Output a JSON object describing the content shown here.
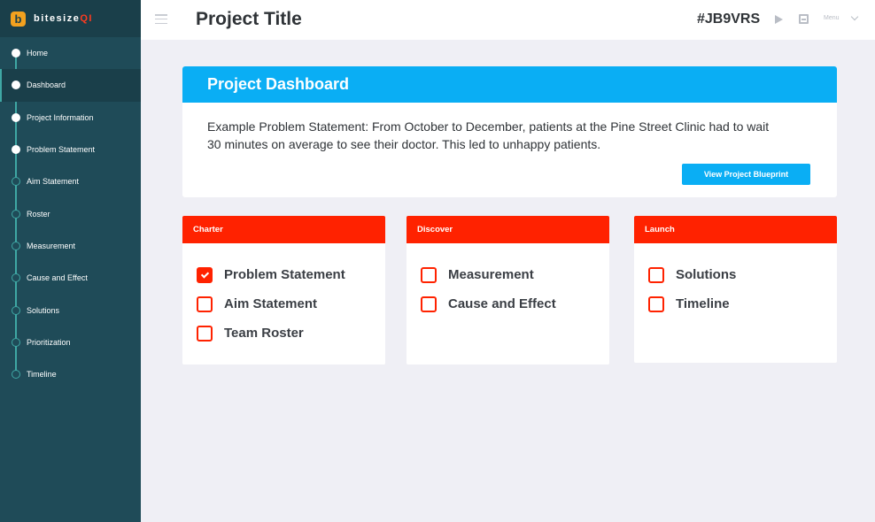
{
  "app": {
    "logo_letter": "b",
    "logo_name_main": "bitesize",
    "logo_name_accent": "QI"
  },
  "sidebar": {
    "items": [
      {
        "label": "Home",
        "state": "done"
      },
      {
        "label": "Dashboard",
        "state": "active"
      },
      {
        "label": "Project Information",
        "state": "done"
      },
      {
        "label": "Problem Statement",
        "state": "done"
      },
      {
        "label": "Aim Statement",
        "state": "todo"
      },
      {
        "label": "Roster",
        "state": "todo"
      },
      {
        "label": "Measurement",
        "state": "todo"
      },
      {
        "label": "Cause and Effect",
        "state": "todo"
      },
      {
        "label": "Solutions",
        "state": "todo"
      },
      {
        "label": "Prioritization",
        "state": "todo"
      },
      {
        "label": "Timeline",
        "state": "todo"
      }
    ]
  },
  "header": {
    "title": "Project Title",
    "project_code": "#JB9VRS",
    "menu_label": "Menu",
    "icons": [
      "hamburger-icon",
      "play-icon",
      "save-icon",
      "chevron-down-icon"
    ]
  },
  "dashboard": {
    "title": "Project Dashboard",
    "problem_statement": "Example Problem Statement: From October to December, patients at the Pine Street Clinic had to wait 30 minutes on average to see their doctor. This led to unhappy patients.",
    "blueprint_button": "View Project Blueprint"
  },
  "phases": [
    {
      "title": "Charter",
      "items": [
        {
          "label": "Problem Statement",
          "checked": true
        },
        {
          "label": "Aim Statement",
          "checked": false
        },
        {
          "label": "Team Roster",
          "checked": false
        }
      ]
    },
    {
      "title": "Discover",
      "items": [
        {
          "label": "Measurement",
          "checked": false
        },
        {
          "label": "Cause and Effect",
          "checked": false
        }
      ]
    },
    {
      "title": "Launch",
      "items": [
        {
          "label": "Solutions",
          "checked": false
        },
        {
          "label": "Timeline",
          "checked": false
        }
      ]
    }
  ],
  "colors": {
    "sidebar_bg": "#1f4b58",
    "accent_teal": "#3fa7a4",
    "primary_blue": "#0aaef4",
    "phase_red": "#ff2200",
    "page_bg": "#efeff5"
  }
}
